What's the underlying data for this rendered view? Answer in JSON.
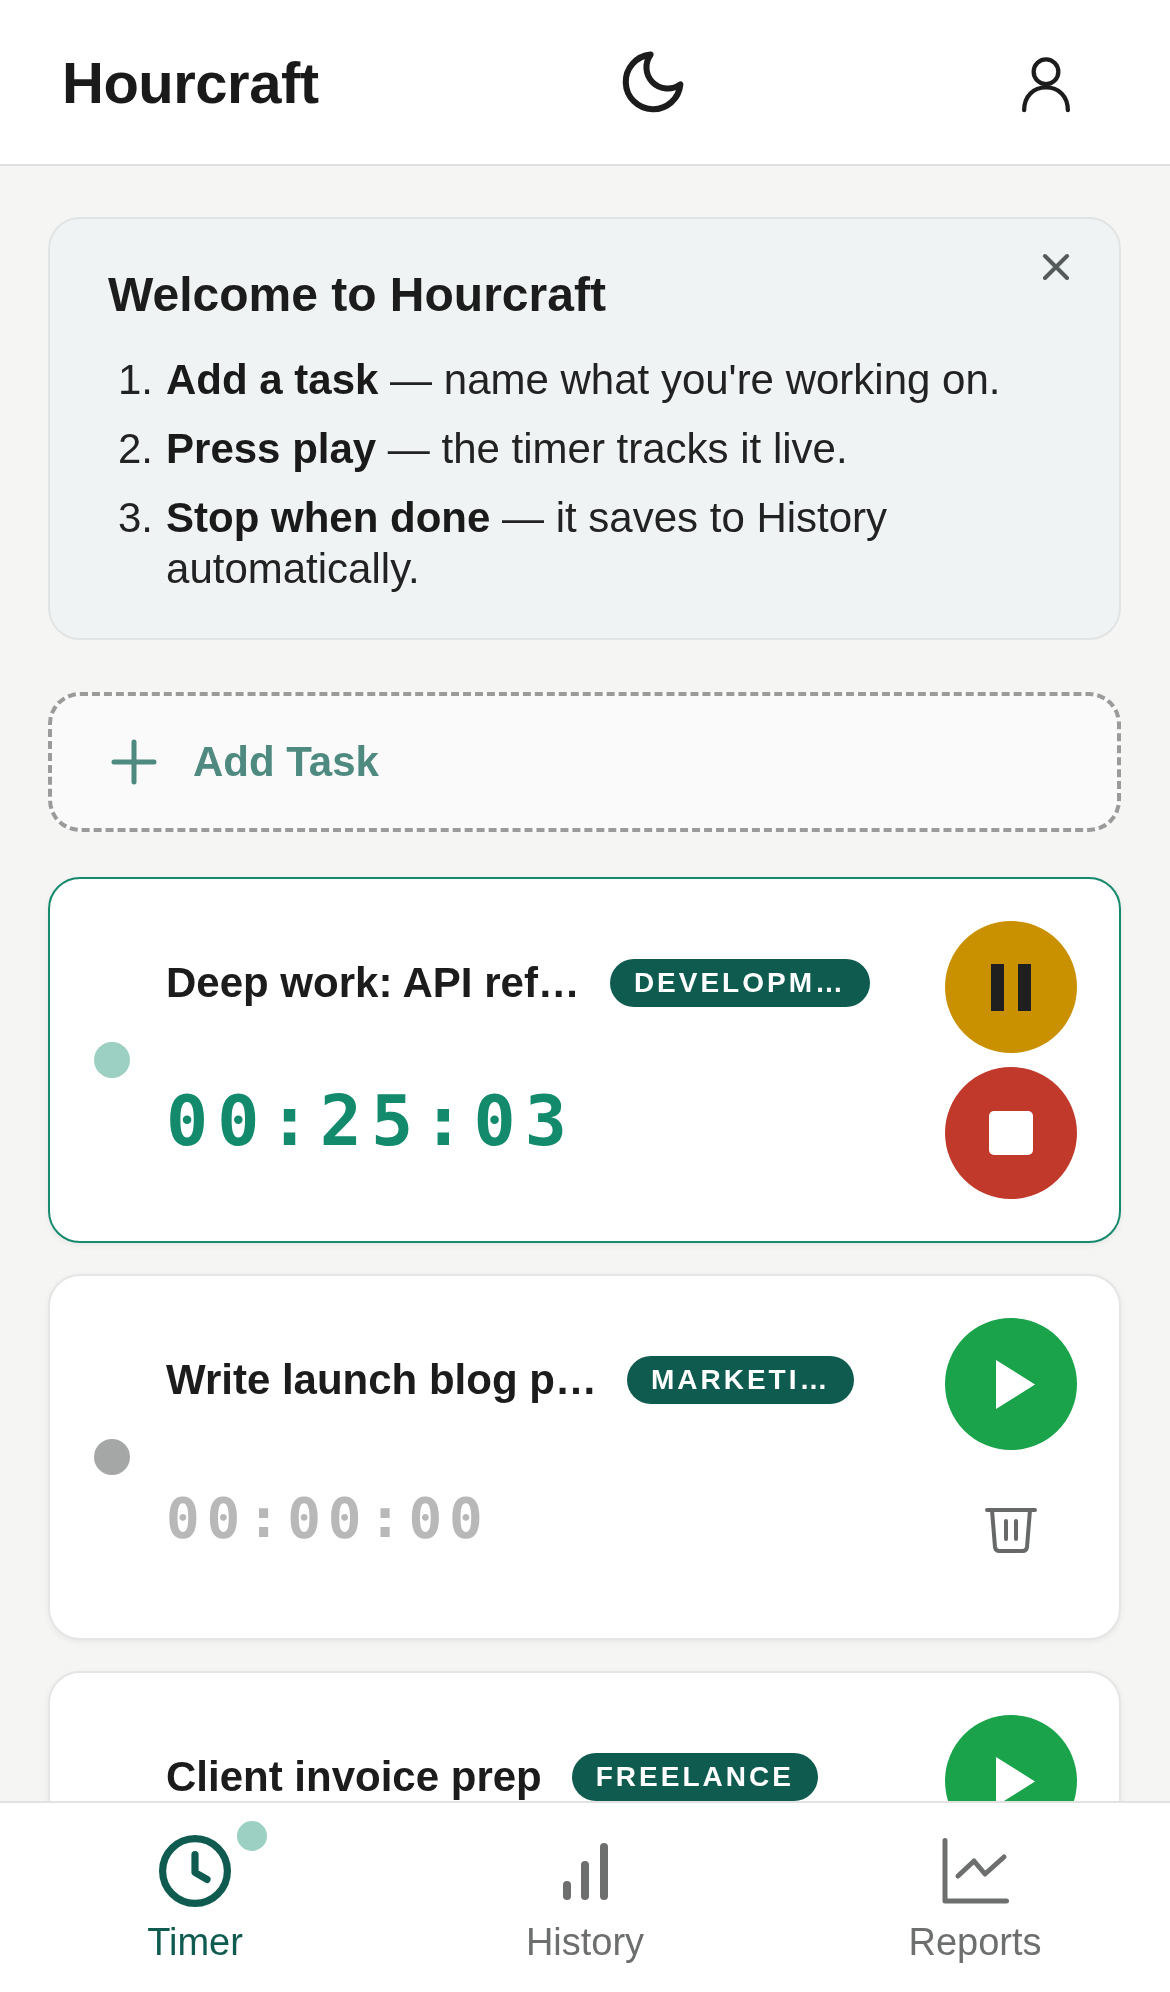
{
  "header": {
    "title": "Hourcraft"
  },
  "welcome": {
    "title": "Welcome to Hourcraft",
    "steps": [
      {
        "number": "1.",
        "text": "**Add a task** — name what you're working on."
      },
      {
        "number": "2.",
        "text": "**Press play** — the timer tracks it live."
      },
      {
        "number": "3.",
        "text": "**Stop when done** — it saves to History automatically."
      }
    ]
  },
  "add_task": {
    "label": "Add Task"
  },
  "tasks": [
    {
      "title": "Deep work: API ref…",
      "tag": "DEVELOPM…",
      "time": "00:25:03",
      "running": true
    },
    {
      "title": "Write launch blog p…",
      "tag": "MARKETI…",
      "time": "00:00:00",
      "running": false
    },
    {
      "title": "Client invoice prep",
      "tag": "FREELANCE",
      "running": false
    }
  ],
  "nav": [
    {
      "kind": "timer",
      "label": "Timer",
      "selected": true,
      "indicator": true
    },
    {
      "kind": "history",
      "label": "History",
      "selected": false,
      "indicator": false
    },
    {
      "kind": "reports",
      "label": "Reports",
      "selected": false,
      "indicator": false
    }
  ]
}
